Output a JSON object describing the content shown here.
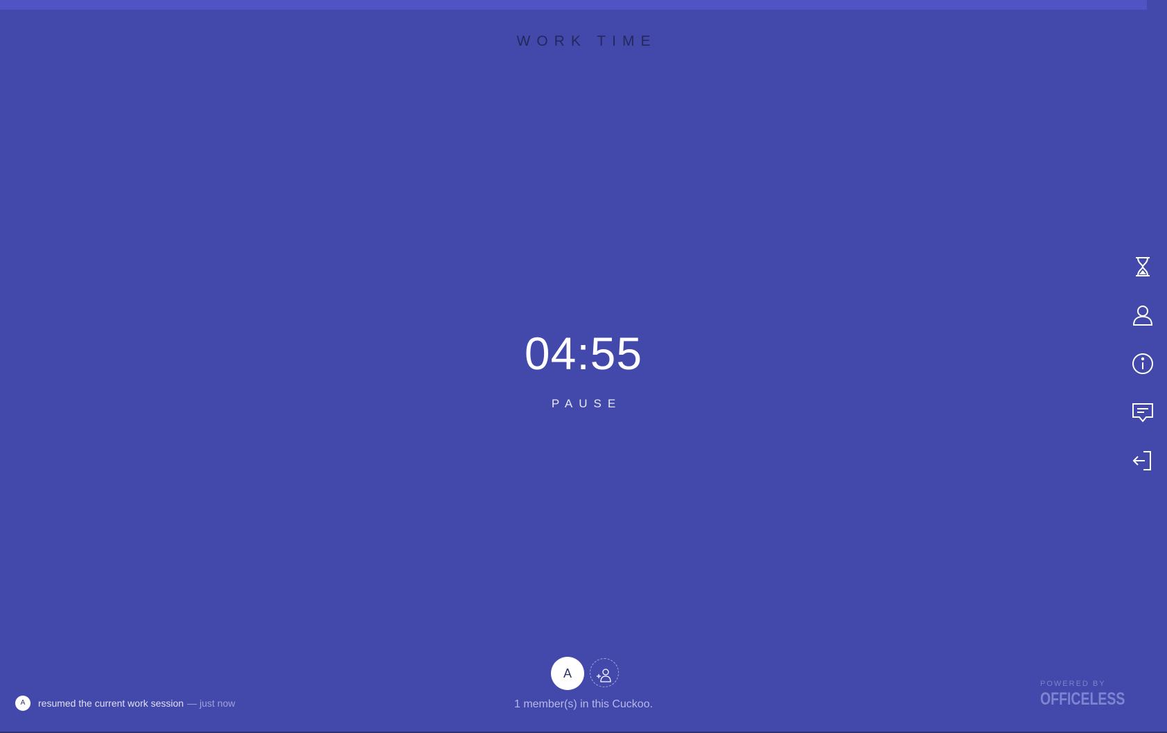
{
  "session": {
    "mode_title": "WORK TIME",
    "timer": "04:55",
    "pause_label": "PAUSE",
    "progress_fraction": 0.017
  },
  "side_nav": [
    {
      "name": "timer-settings",
      "icon": "hourglass-icon"
    },
    {
      "name": "profile",
      "icon": "user-icon"
    },
    {
      "name": "info",
      "icon": "info-icon"
    },
    {
      "name": "feedback",
      "icon": "chat-icon"
    },
    {
      "name": "leave",
      "icon": "exit-icon"
    }
  ],
  "members": {
    "avatars": [
      "A"
    ],
    "add_icon": "add-user-icon",
    "count_text": "1 member(s) in this Cuckoo."
  },
  "activity": {
    "avatar": "A",
    "text": "resumed the current work session",
    "time": "— just now"
  },
  "branding": {
    "powered_by": "POWERED BY",
    "logo": "OFFICELESS"
  },
  "colors": {
    "background": "#4349aa",
    "progress": "#4f53c3",
    "text_light": "#ffffff",
    "title_dark": "#24285d"
  }
}
